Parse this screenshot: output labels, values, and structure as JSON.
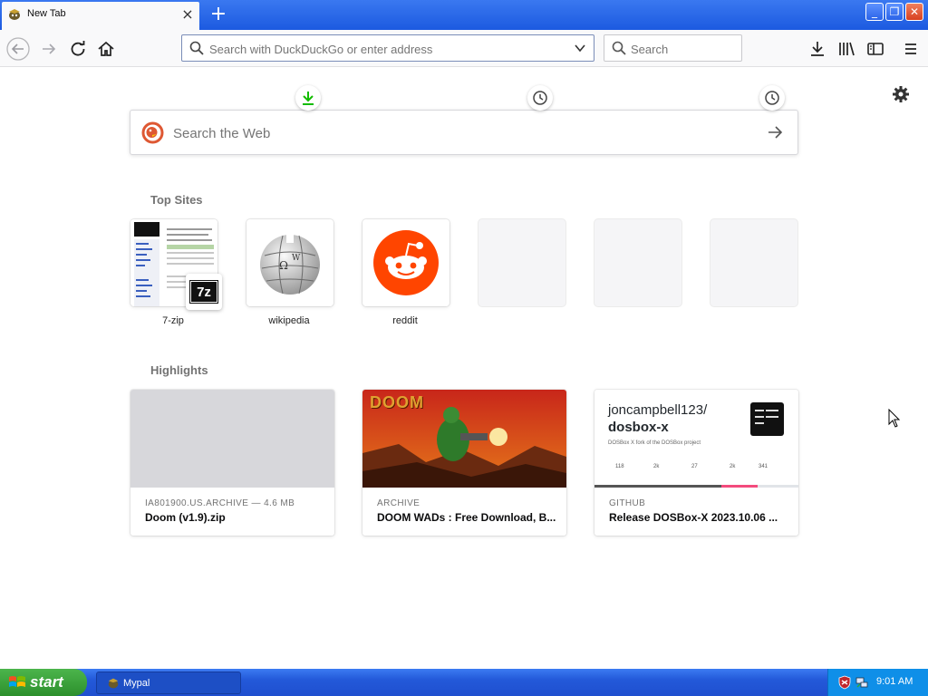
{
  "window": {
    "tab_title": "New Tab",
    "new_tab_symbol": "+",
    "close_tab_symbol": "×",
    "controls": {
      "minimize": "_",
      "restore": "❐",
      "close": "✕"
    }
  },
  "nav": {
    "url_placeholder": "Search with DuckDuckGo or enter address",
    "search_placeholder": "Search"
  },
  "newtab": {
    "web_search_placeholder": "Search the Web",
    "top_sites_title": "Top Sites",
    "top_sites": [
      {
        "label": "7-zip"
      },
      {
        "label": "wikipedia"
      },
      {
        "label": "reddit"
      }
    ],
    "highlights_title": "Highlights",
    "highlights": [
      {
        "source": "IA801900.US.ARCHIVE — 4.6 MB",
        "title": "Doom (v1.9).zip"
      },
      {
        "source": "ARCHIVE",
        "title": "DOOM WADs : Free Download, B..."
      },
      {
        "source": "GITHUB",
        "title": "Release DOSBox-X 2023.10.06 ..."
      }
    ],
    "github_card": {
      "repo_owner": "joncampbell123/",
      "repo_name": "dosbox-x",
      "description": "DOSBox X fork of the DOSBox project",
      "stats": [
        "118",
        "2k",
        "27",
        "2k",
        "341"
      ]
    },
    "doom_logo": "DOOM",
    "sevenzip_logo": "7z"
  },
  "taskbar": {
    "start_label": "start",
    "task_label": "Mypal",
    "clock": "9:01 AM"
  },
  "colors": {
    "titlebar": "#1c5ae0",
    "reddit": "#ff4500",
    "download_green": "#12bc00",
    "start_green": "#2c8f2c"
  }
}
